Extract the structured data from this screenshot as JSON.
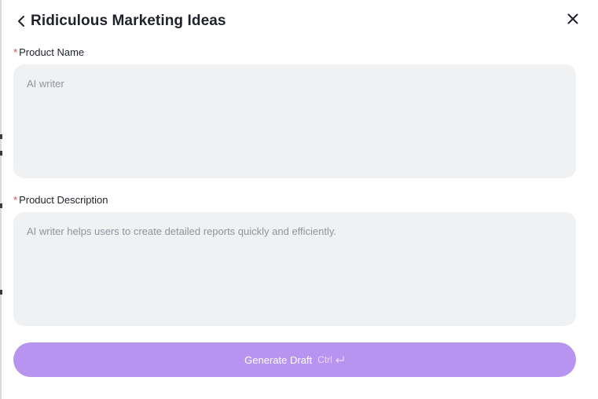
{
  "header": {
    "title": "Ridiculous Marketing Ideas",
    "back_icon": "chevron-left-icon",
    "close_icon": "close-icon"
  },
  "fields": {
    "product_name": {
      "label": "Product Name",
      "required_marker": "*",
      "value": "",
      "placeholder": "AI writer"
    },
    "product_description": {
      "label": "Product Description",
      "required_marker": "*",
      "value": "",
      "placeholder": "AI writer helps users to create detailed reports quickly and efficiently."
    }
  },
  "actions": {
    "generate_label": "Generate Draft",
    "shortcut_label": "Ctrl",
    "shortcut_icon": "enter-key-icon"
  },
  "colors": {
    "accent": "#b794f0",
    "required": "#e5484d",
    "field_background": "#f0f1f3"
  }
}
